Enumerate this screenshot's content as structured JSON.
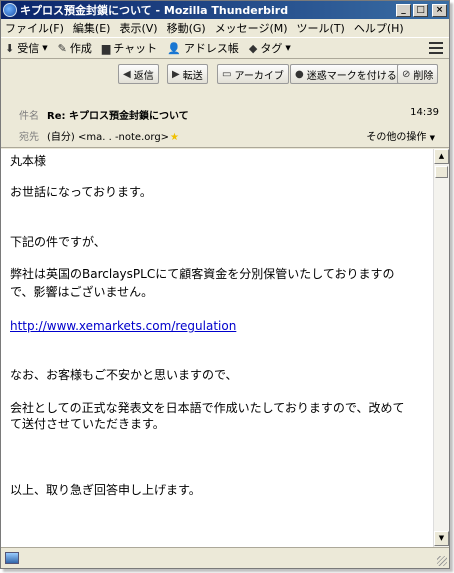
{
  "window": {
    "title": "キプロス預金封鎖について - Mozilla Thunderbird",
    "minimize": "_",
    "maximize": "□",
    "close": "×"
  },
  "menu": [
    "ファイル(F)",
    "編集(E)",
    "表示(V)",
    "移動(G)",
    "メッセージ(M)",
    "ツール(T)",
    "ヘルプ(H)"
  ],
  "toolbar": {
    "receive": "受信",
    "compose": "作成",
    "chat": "チャット",
    "address_book": "アドレス帳",
    "tag": "タグ"
  },
  "actions": {
    "reply": "返信",
    "forward": "転送",
    "archive": "アーカイブ",
    "junk": "迷惑マークを付ける",
    "delete": "削除"
  },
  "header": {
    "subject_label": "件名",
    "subject": "Re: キプロス預金封鎖について",
    "time": "14:39",
    "from_label": "宛先",
    "from": "(自分) <ma.            .                -note.org>",
    "other_actions": "その他の操作"
  },
  "body": {
    "lines": [
      "丸本様",
      "お世話になっております。",
      "下記の件ですが、",
      "弊社は英国のBarclaysPLCにて顧客資金を分別保管いたしておりますの",
      "で、影響はございません。",
      "http://www.xemarkets.com/regulation",
      "なお、お客様もご不安かと思いますので、",
      "会社としての正式な発表文を日本語で作成いたしておりますので、改めて",
      "て送付させていただきます。",
      "以上、取り急ぎ回答申し上げます。"
    ]
  },
  "icons": {
    "receive": "inbox-download-icon",
    "compose": "pencil-icon",
    "chat": "chat-bubble-icon",
    "address_book": "person-icon",
    "tag": "tag-icon",
    "reply": "reply-arrow-icon",
    "forward": "forward-arrow-icon",
    "archive": "archive-box-icon",
    "junk": "junk-flame-icon",
    "delete": "delete-circle-icon",
    "star": "star-icon"
  },
  "colors": {
    "titlebar_start": "#0a246a",
    "titlebar_end": "#3a6ea5",
    "link": "#0000cc",
    "chrome": "#ece9d8"
  }
}
